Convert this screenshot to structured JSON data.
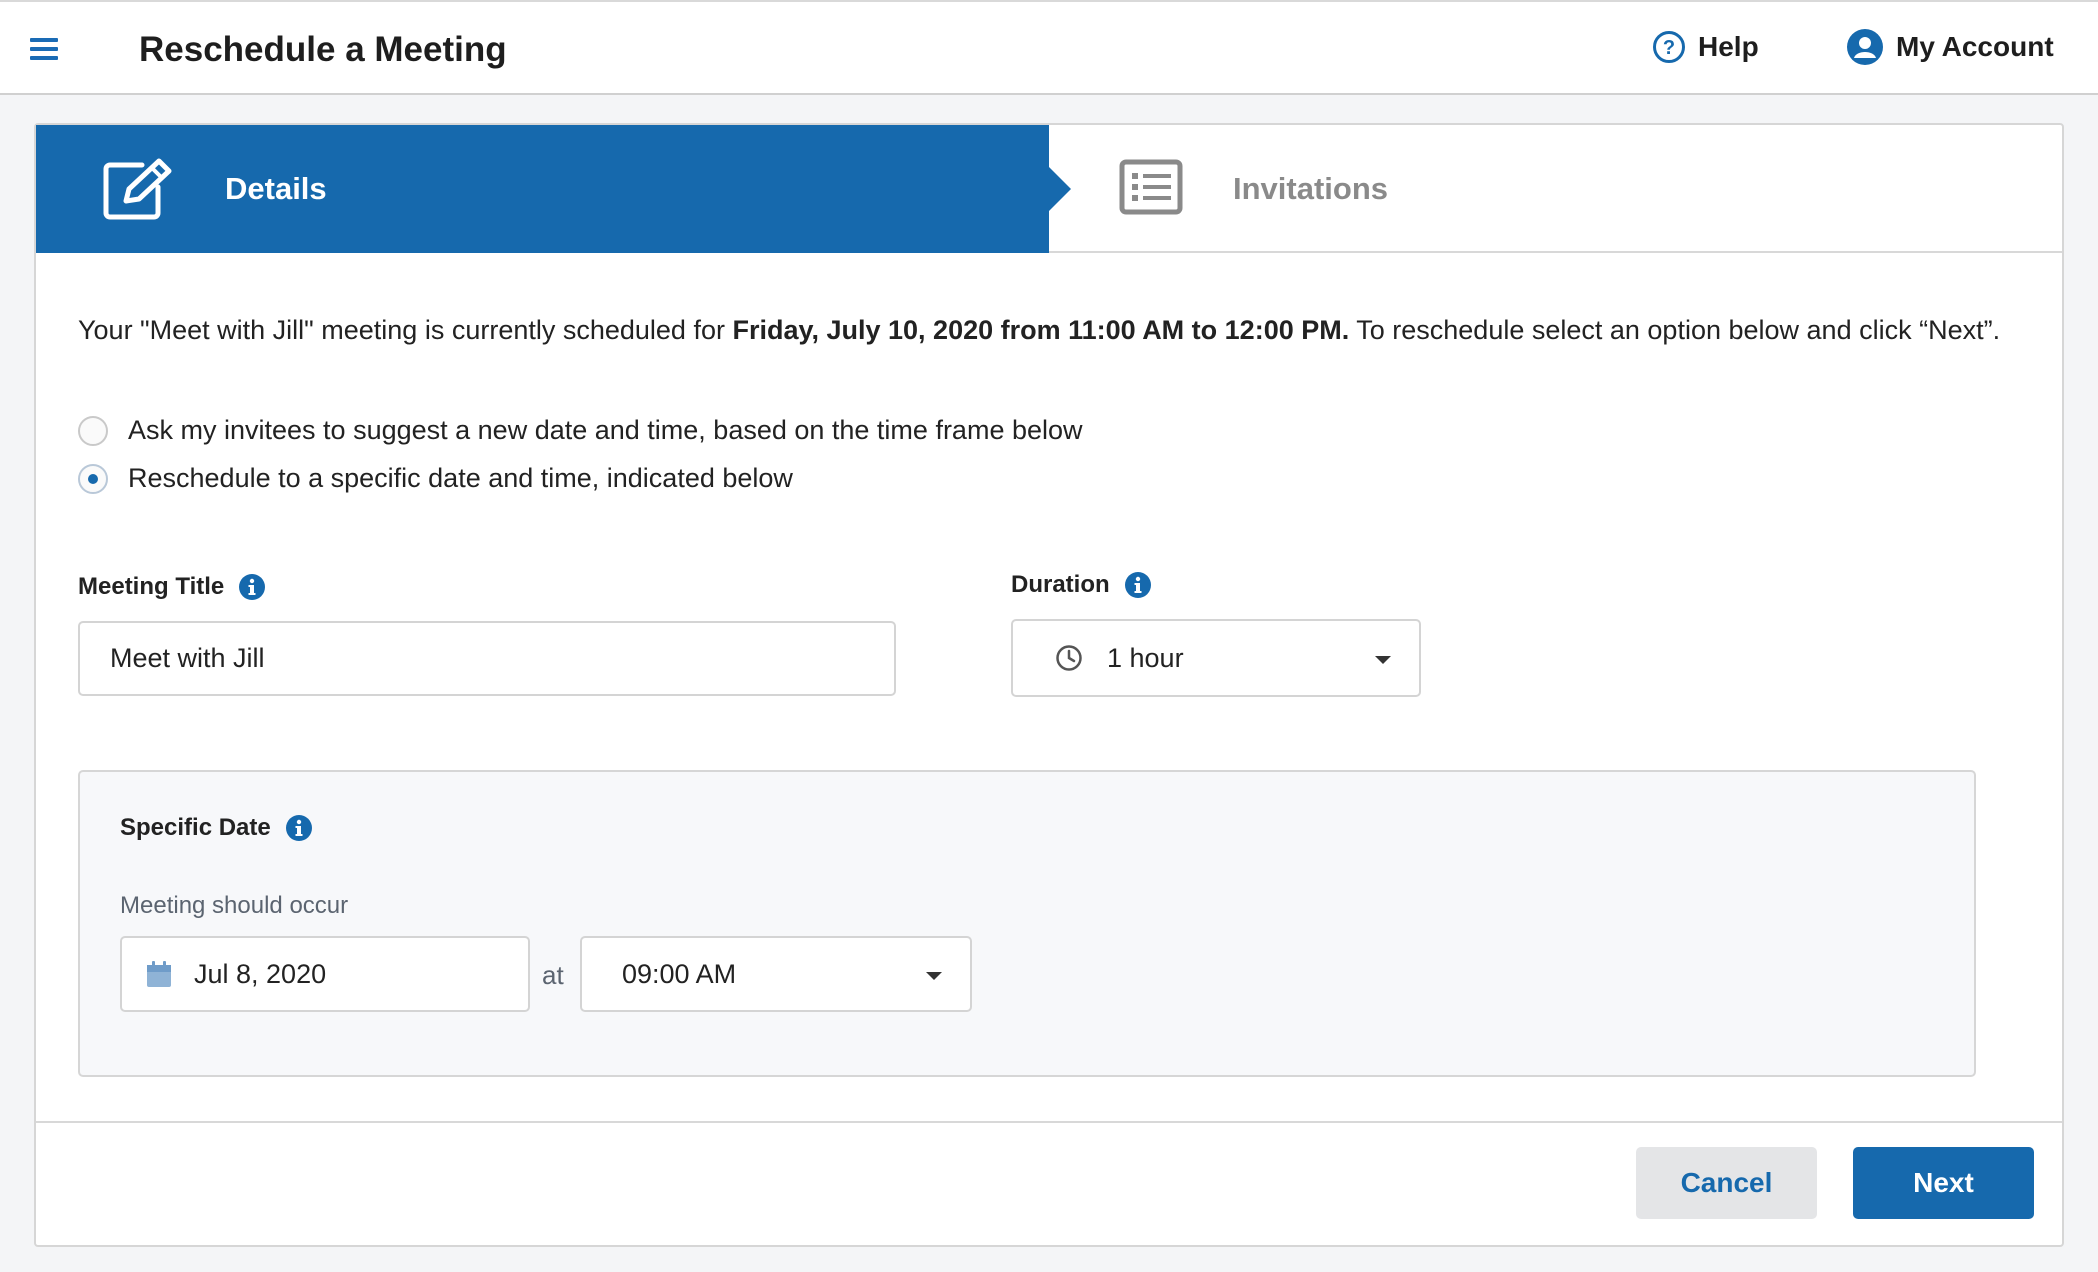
{
  "header": {
    "title": "Reschedule a Meeting",
    "help_label": "Help",
    "account_label": "My Account"
  },
  "steps": [
    {
      "label": "Details",
      "icon": "edit-icon",
      "active": true
    },
    {
      "label": "Invitations",
      "icon": "list-icon",
      "active": false
    }
  ],
  "intro": {
    "prefix": "Your \"Meet with Jill\" meeting is currently scheduled for ",
    "bold": "Friday, July 10, 2020 from 11:00 AM to 12:00 PM.",
    "suffix": " To reschedule select an option below and click “Next”."
  },
  "options": [
    {
      "label": "Ask my invitees to suggest a new date and time, based on the time frame below",
      "checked": false
    },
    {
      "label": "Reschedule to a specific date and time, indicated below",
      "checked": true
    }
  ],
  "meeting_title": {
    "label": "Meeting Title",
    "value": "Meet with Jill"
  },
  "duration": {
    "label": "Duration",
    "value": "1 hour"
  },
  "specific_date": {
    "label": "Specific Date",
    "sublabel": "Meeting should occur",
    "date_value": "Jul 8, 2020",
    "at_label": "at",
    "time_value": "09:00 AM"
  },
  "buttons": {
    "cancel": "Cancel",
    "next": "Next"
  },
  "colors": {
    "primary": "#1669ad",
    "inactive_text": "#8a8a8a",
    "panel_bg": "#f7f8fa"
  }
}
